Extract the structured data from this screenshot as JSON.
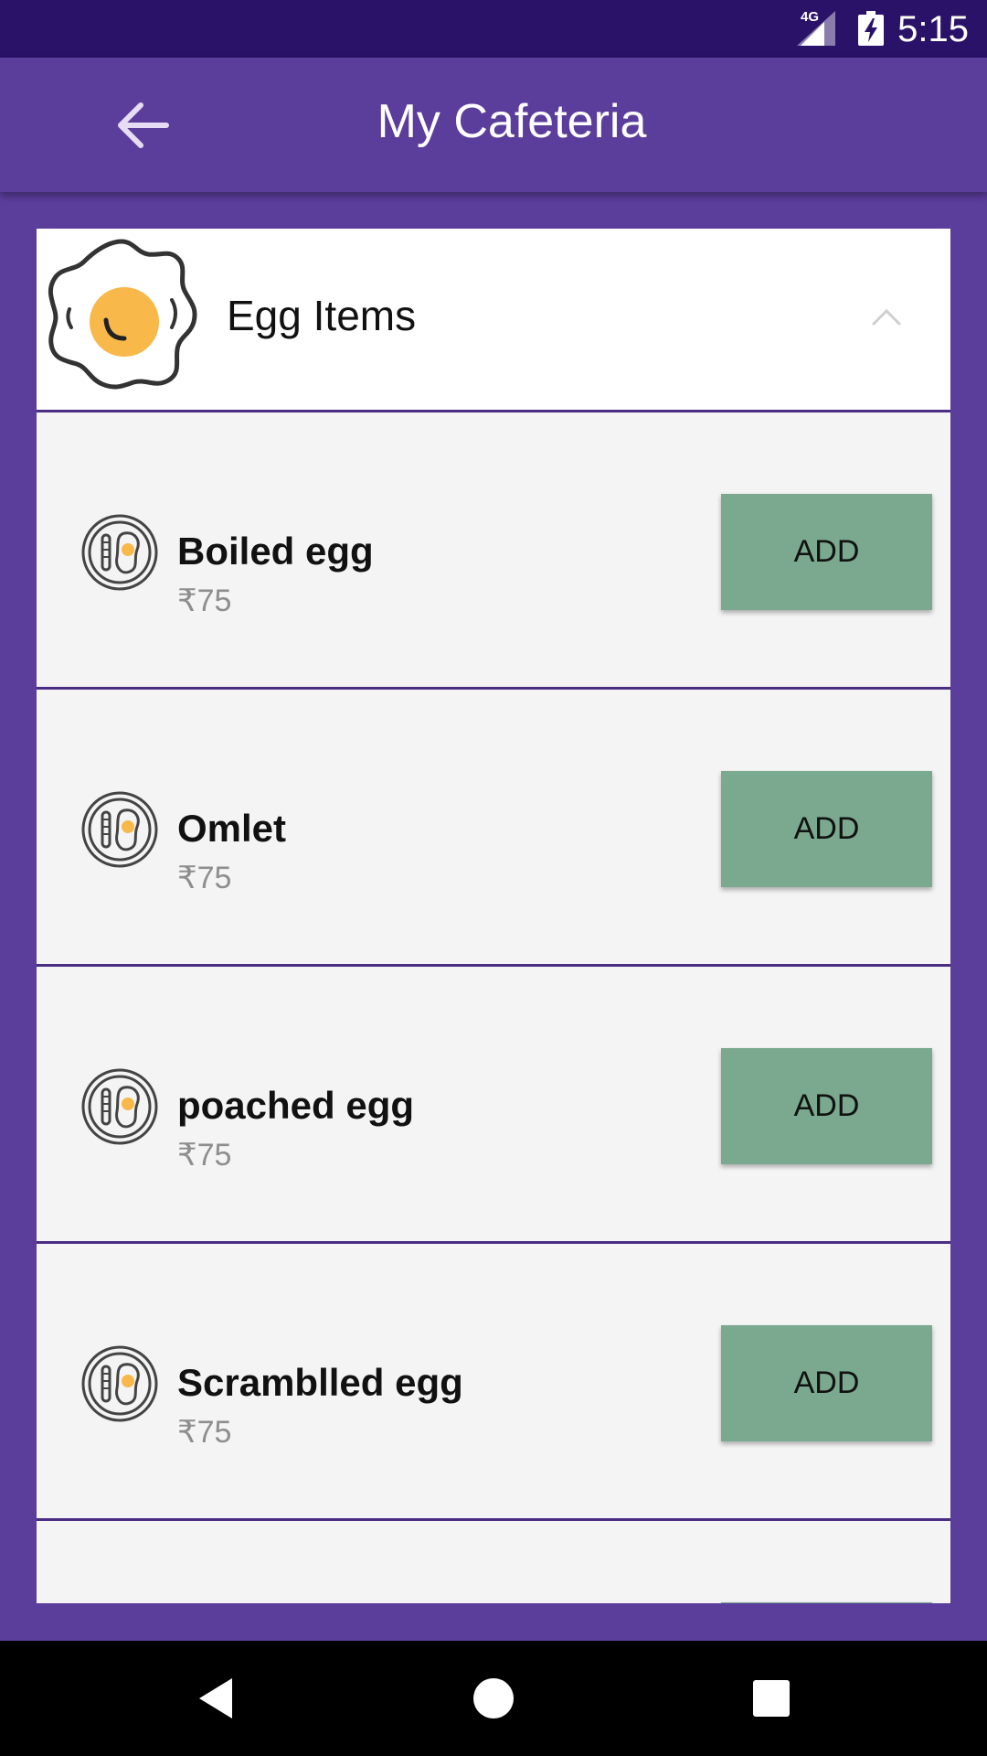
{
  "status_bar": {
    "network": "4G",
    "time": "5:15"
  },
  "app_bar": {
    "title": "My Cafeteria",
    "back_icon": "arrow-back-icon"
  },
  "category": {
    "title": "Egg Items",
    "icon": "fried-egg-icon",
    "expanded": true,
    "items": [
      {
        "name": "Boiled egg",
        "price": "₹75",
        "button": "ADD"
      },
      {
        "name": "Omlet",
        "price": "₹75",
        "button": "ADD"
      },
      {
        "name": "poached egg",
        "price": "₹75",
        "button": "ADD"
      },
      {
        "name": "Scramblled egg",
        "price": "₹75",
        "button": "ADD"
      }
    ]
  },
  "colors": {
    "status_bar": "#2a1268",
    "primary": "#5b3d9b",
    "add_button": "#7aa98f",
    "divider": "#4b2e83"
  }
}
